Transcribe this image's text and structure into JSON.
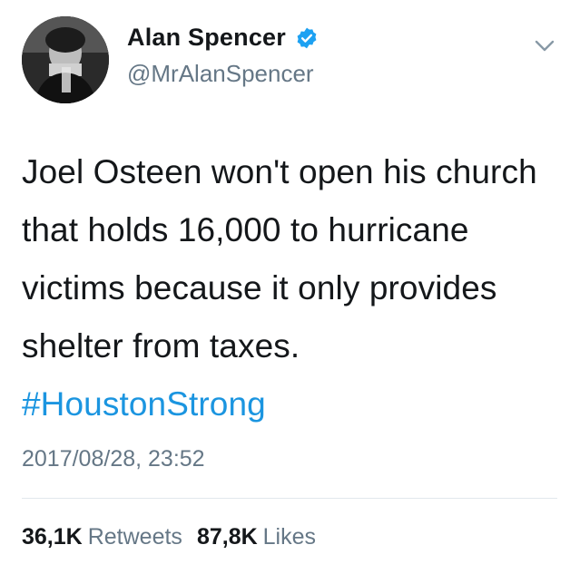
{
  "author": {
    "display_name": "Alan Spencer",
    "handle": "@MrAlanSpencer",
    "verified": true,
    "verified_icon": "verified-badge-icon",
    "avatar_icon": "profile-photo"
  },
  "tweet": {
    "text": "Joel Osteen won't open his church that holds 16,000 to hurricane victims because it only provides shelter from taxes.",
    "hashtag": "#HoustonStrong",
    "timestamp": "2017/08/28, 23:52"
  },
  "stats": {
    "retweets_count": "36,1K",
    "retweets_label": "Retweets",
    "likes_count": "87,8K",
    "likes_label": "Likes"
  },
  "menu": {
    "icon": "chevron-down-icon"
  },
  "colors": {
    "text": "#14171a",
    "secondary": "#657786",
    "link": "#1b95e0",
    "verified": "#1da1f2",
    "divider": "#e1e8ed"
  }
}
